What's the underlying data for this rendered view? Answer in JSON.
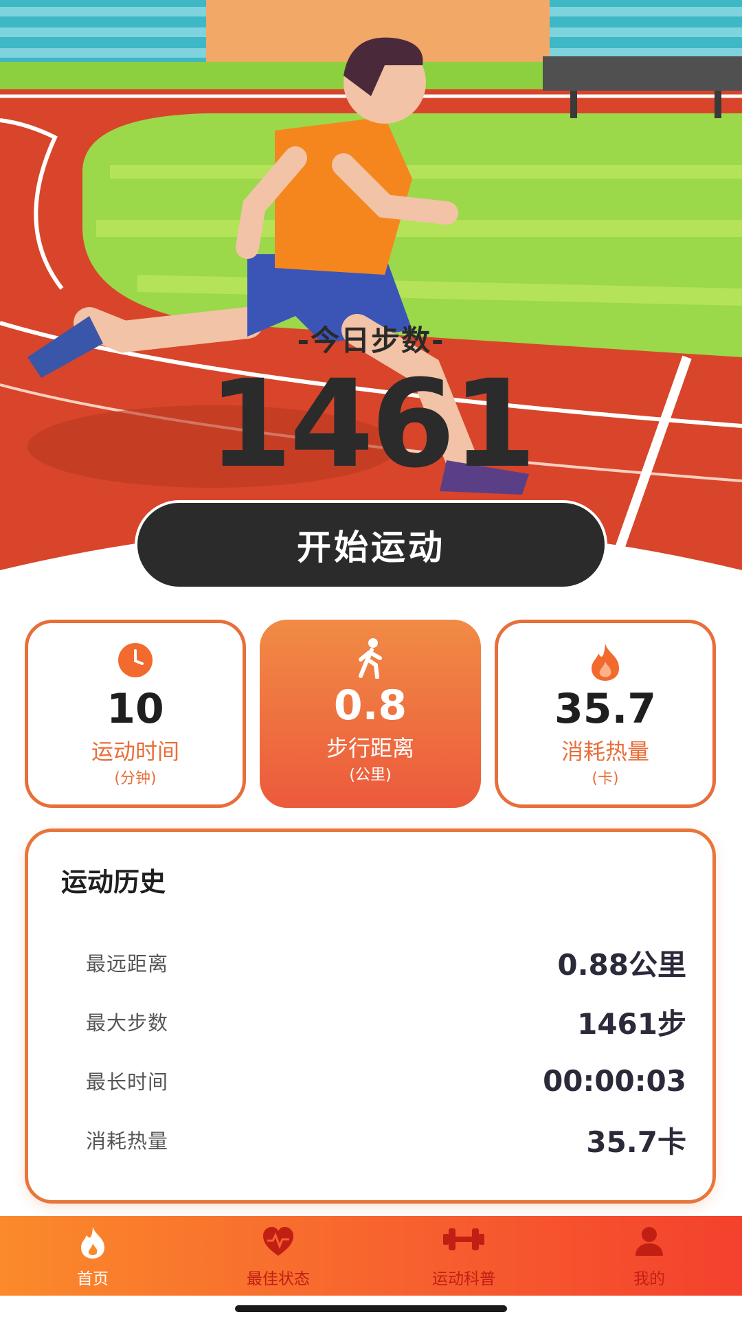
{
  "hero": {
    "today_label": "-今日步数-",
    "today_steps": "1461",
    "start_button": "开始运动"
  },
  "stats": [
    {
      "icon": "clock-icon",
      "value": "10",
      "label": "运动时间",
      "unit": "(分钟)"
    },
    {
      "icon": "walk-icon",
      "value": "0.8",
      "label": "步行距离",
      "unit": "(公里)"
    },
    {
      "icon": "flame-icon",
      "value": "35.7",
      "label": "消耗热量",
      "unit": "(卡)"
    }
  ],
  "history": {
    "title": "运动历史",
    "rows": [
      {
        "key": "最远距离",
        "value": "0.88公里"
      },
      {
        "key": "最大步数",
        "value": "1461步"
      },
      {
        "key": "最长时间",
        "value": "00:00:03"
      },
      {
        "key": "消耗热量",
        "value": "35.7卡"
      }
    ]
  },
  "tabbar": {
    "tabs": [
      {
        "label": "首页",
        "icon": "flame-icon",
        "active": true
      },
      {
        "label": "最佳状态",
        "icon": "heart-pulse-icon",
        "active": false
      },
      {
        "label": "运动科普",
        "icon": "dumbbell-icon",
        "active": false
      },
      {
        "label": "我的",
        "icon": "person-icon",
        "active": false
      }
    ]
  },
  "colors": {
    "accent": "#e86e3a",
    "tab_gradient_start": "#fb8a2b",
    "tab_gradient_end": "#f4412d",
    "dark_button": "#2b2b2b"
  }
}
